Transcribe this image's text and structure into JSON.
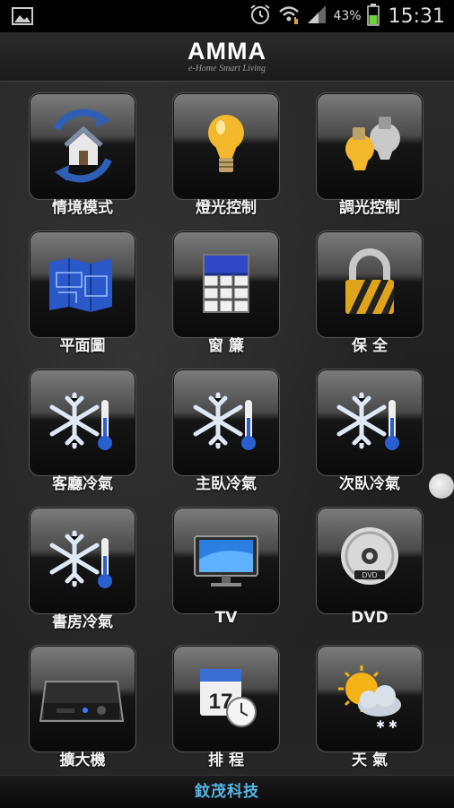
{
  "status_bar": {
    "battery_percent": "43%",
    "time": "15:31",
    "icons": [
      "gallery-icon",
      "alarm-icon",
      "wifi-icon",
      "signal-icon",
      "battery-icon"
    ]
  },
  "header": {
    "title": "AMMA",
    "subtitle": "e-Home Smart Living"
  },
  "tiles": [
    {
      "label": "情境模式",
      "icon": "scene-house-icon"
    },
    {
      "label": "燈光控制",
      "icon": "light-bulb-icon"
    },
    {
      "label": "調光控制",
      "icon": "dimmer-bulbs-icon"
    },
    {
      "label": "平面圖",
      "icon": "floor-plan-icon"
    },
    {
      "label": "窗 簾",
      "icon": "curtain-icon"
    },
    {
      "label": "保 全",
      "icon": "padlock-icon"
    },
    {
      "label": "客廳冷氣",
      "icon": "snowflake-thermometer-icon"
    },
    {
      "label": "主臥冷氣",
      "icon": "snowflake-thermometer-icon"
    },
    {
      "label": "次臥冷氣",
      "icon": "snowflake-thermometer-icon"
    },
    {
      "label": "書房冷氣",
      "icon": "snowflake-thermometer-icon"
    },
    {
      "label": "TV",
      "icon": "tv-icon"
    },
    {
      "label": "DVD",
      "icon": "dvd-disc-icon"
    },
    {
      "label": "擴大機",
      "icon": "amplifier-icon"
    },
    {
      "label": "排 程",
      "icon": "calendar-clock-icon"
    },
    {
      "label": "天 氣",
      "icon": "weather-icon"
    }
  ],
  "footer": {
    "company": "鈫茂科技"
  },
  "colors": {
    "footer_text": "#59b6e8",
    "background": "#222222"
  }
}
